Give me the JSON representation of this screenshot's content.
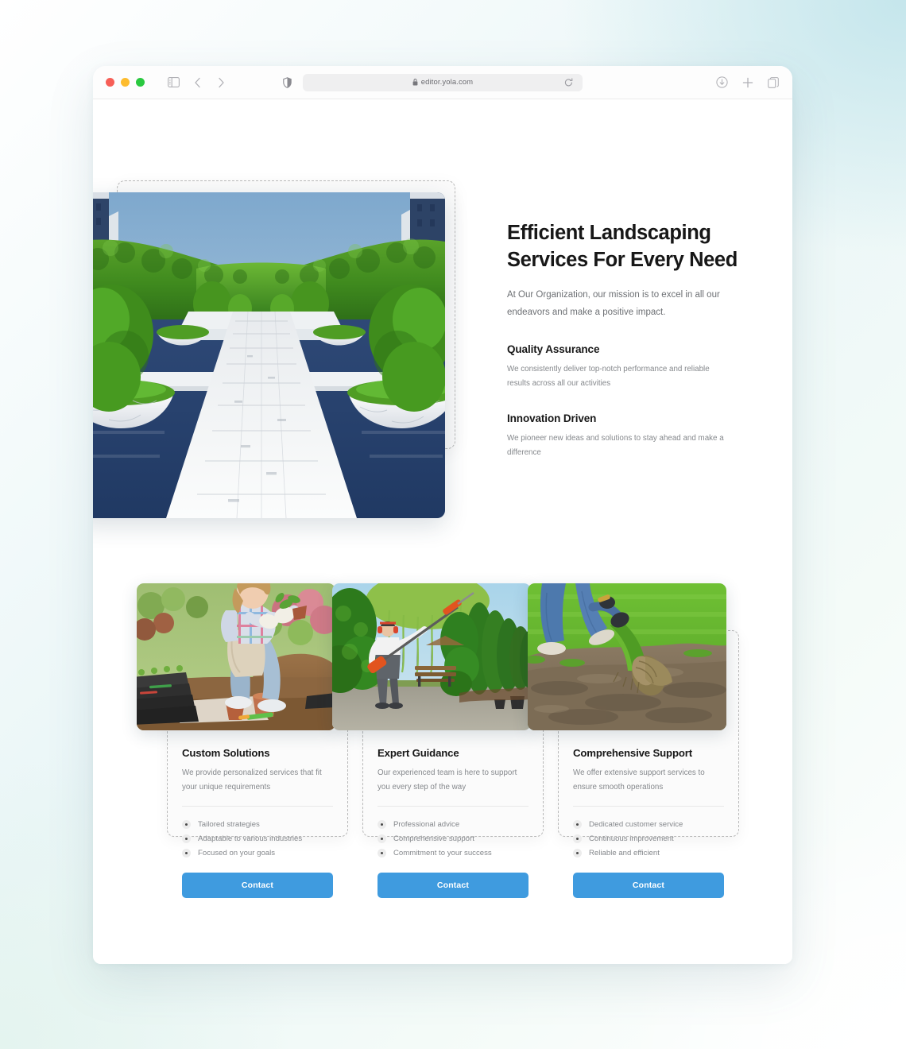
{
  "browser": {
    "url": "editor.yola.com",
    "lock_icon": "lock-icon",
    "traffic_lights": [
      "close-red",
      "minimize-yellow",
      "zoom-green"
    ],
    "sidebar_toggle_icon": "sidebar-toggle-icon",
    "back_icon": "chevron-left-icon",
    "forward_icon": "chevron-right-icon",
    "shield_icon": "shield-privacy-icon",
    "reload_icon": "reload-icon",
    "download_icon": "download-icon",
    "new_tab_icon": "plus-icon",
    "tab_overview_icon": "tab-overview-icon"
  },
  "hero": {
    "title": "Efficient Landscaping Services For Every Need",
    "subtitle": "At Our Organization, our mission is to excel in all our endeavors and make a positive impact.",
    "image_alt": "formal-garden-hedges-walkway",
    "features": [
      {
        "title": "Quality Assurance",
        "description": "We consistently deliver top-notch performance and reliable results across all our activities"
      },
      {
        "title": "Innovation Driven",
        "description": "We pioneer new ideas and solutions to stay ahead and make a difference"
      }
    ]
  },
  "cards": [
    {
      "title": "Custom Solutions",
      "description": "We provide personalized services that fit your unique requirements",
      "image_alt": "gardener-planting-seedlings",
      "bullets": [
        "Tailored strategies",
        "Adaptable to various industries",
        "Focused on your goals"
      ],
      "button_label": "Contact"
    },
    {
      "title": "Expert Guidance",
      "description": "Our experienced team is here to support you every step of the way",
      "image_alt": "worker-trimming-topiary-hedges",
      "bullets": [
        "Professional advice",
        "Comprehensive support",
        "Commitment to your success"
      ],
      "button_label": "Contact"
    },
    {
      "title": "Comprehensive Support",
      "description": "We offer extensive support services to ensure smooth operations",
      "image_alt": "laying-sod-turf-roll",
      "bullets": [
        "Dedicated customer service",
        "Continuous improvement",
        "Reliable and efficient"
      ],
      "button_label": "Contact"
    }
  ],
  "colors": {
    "accent_blue": "#3f9bdf",
    "heading": "#171717",
    "body_text": "#85888c",
    "selection_dash": "#b9b9b9",
    "page_bg_cyan": "#c5e6ec",
    "page_bg_mint": "#e4f4ef"
  }
}
